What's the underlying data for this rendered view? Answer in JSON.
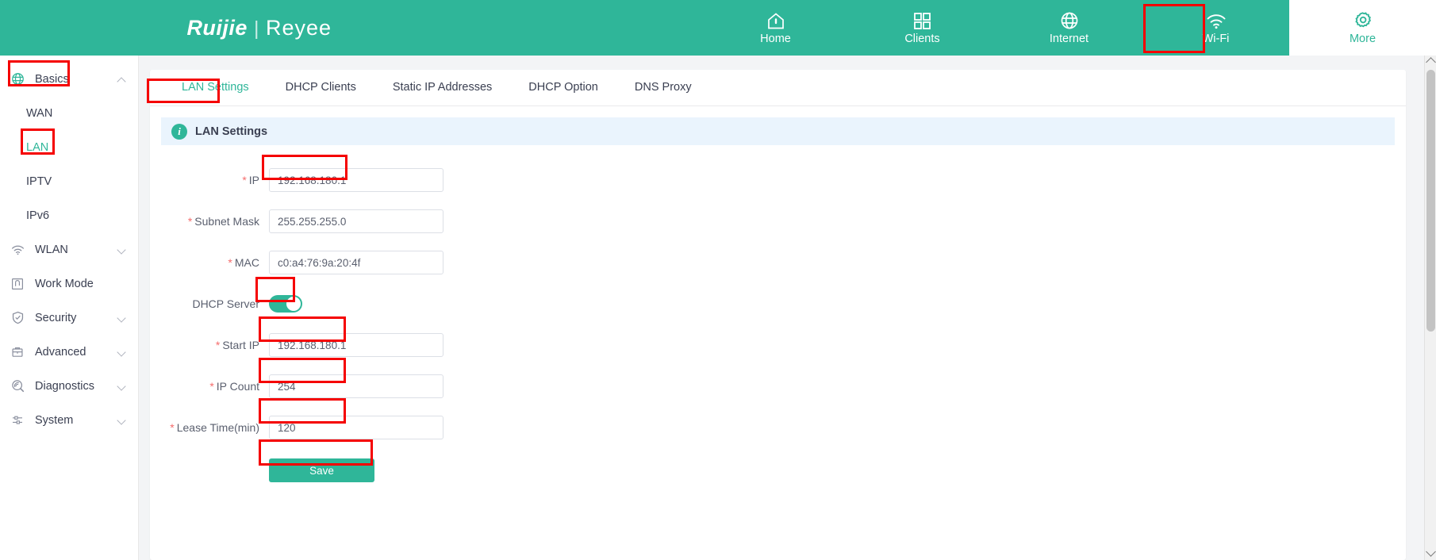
{
  "header": {
    "brand_primary": "Ruijie",
    "brand_separator": "|",
    "brand_secondary": "Reyee",
    "accent_color": "#2fb699",
    "annotation_color": "#f50000",
    "nav": [
      {
        "label": "Home",
        "icon": "home-icon",
        "active": false
      },
      {
        "label": "Clients",
        "icon": "grid-icon",
        "active": false
      },
      {
        "label": "Internet",
        "icon": "globe-icon",
        "active": false
      },
      {
        "label": "Wi-Fi",
        "icon": "wifi-icon",
        "active": false
      },
      {
        "label": "More",
        "icon": "gear-icon",
        "active": true
      }
    ]
  },
  "sidebar": {
    "items": [
      {
        "label": "Basics",
        "icon": "globe-icon",
        "expanded": true,
        "chevron": "up",
        "active": false,
        "sub": false
      },
      {
        "label": "WAN",
        "icon": "",
        "chevron": "",
        "active": false,
        "sub": true
      },
      {
        "label": "LAN",
        "icon": "",
        "chevron": "",
        "active": true,
        "sub": true
      },
      {
        "label": "IPTV",
        "icon": "",
        "chevron": "",
        "active": false,
        "sub": true
      },
      {
        "label": "IPv6",
        "icon": "",
        "chevron": "",
        "active": false,
        "sub": true
      },
      {
        "label": "WLAN",
        "icon": "wifi-icon",
        "chevron": "down",
        "active": false,
        "sub": false
      },
      {
        "label": "Work Mode",
        "icon": "work-mode-icon",
        "chevron": "",
        "active": false,
        "sub": false
      },
      {
        "label": "Security",
        "icon": "shield-icon",
        "chevron": "down",
        "active": false,
        "sub": false
      },
      {
        "label": "Advanced",
        "icon": "briefcase-icon",
        "chevron": "down",
        "active": false,
        "sub": false
      },
      {
        "label": "Diagnostics",
        "icon": "diagnostics-icon",
        "chevron": "down",
        "active": false,
        "sub": false
      },
      {
        "label": "System",
        "icon": "system-icon",
        "chevron": "down",
        "active": false,
        "sub": false
      }
    ]
  },
  "main": {
    "tabs": [
      {
        "label": "LAN Settings",
        "active": true
      },
      {
        "label": "DHCP Clients",
        "active": false
      },
      {
        "label": "Static IP Addresses",
        "active": false
      },
      {
        "label": "DHCP Option",
        "active": false
      },
      {
        "label": "DNS Proxy",
        "active": false
      }
    ],
    "banner": {
      "icon": "info-icon",
      "glyph": "i",
      "title": "LAN Settings"
    },
    "form": {
      "fields": [
        {
          "label": "IP",
          "required": true,
          "value": "192.168.180.1",
          "type": "text",
          "highlighted": true
        },
        {
          "label": "Subnet Mask",
          "required": true,
          "value": "255.255.255.0",
          "type": "text",
          "highlighted": false
        },
        {
          "label": "MAC",
          "required": true,
          "value": "c0:a4:76:9a:20:4f",
          "type": "text",
          "highlighted": false
        },
        {
          "label": "DHCP Server",
          "required": false,
          "value": "on",
          "type": "toggle",
          "highlighted": true
        },
        {
          "label": "Start IP",
          "required": true,
          "value": "192.168.180.1",
          "type": "text",
          "highlighted": true
        },
        {
          "label": "IP Count",
          "required": true,
          "value": "254",
          "type": "text",
          "highlighted": true
        },
        {
          "label": "Lease Time(min)",
          "required": true,
          "value": "120",
          "type": "text",
          "highlighted": true
        }
      ],
      "save_label": "Save",
      "required_marker": "*"
    }
  }
}
